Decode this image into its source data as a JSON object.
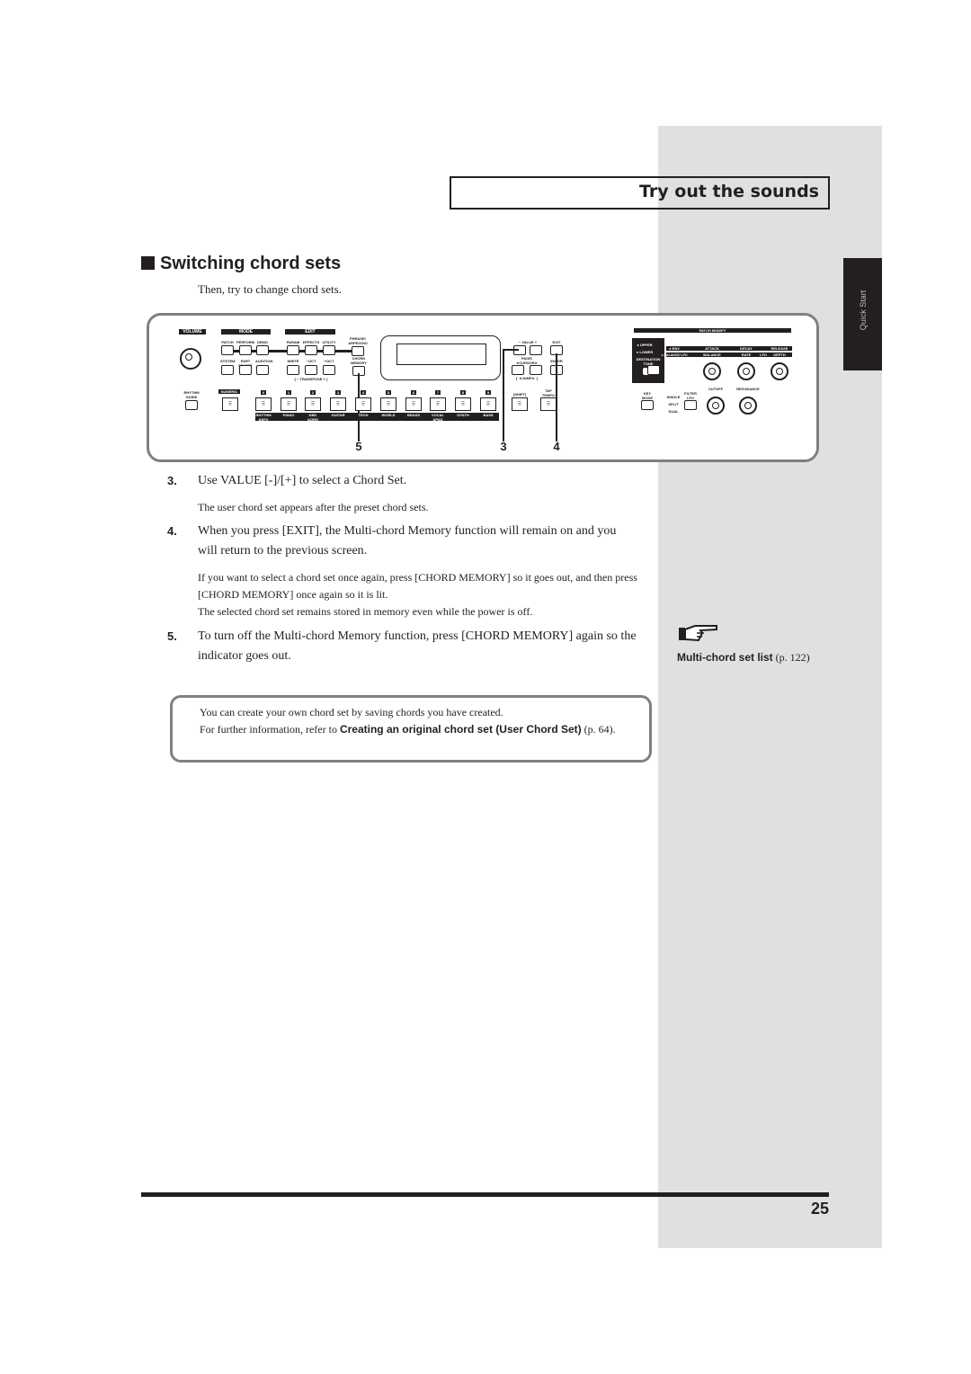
{
  "header": {
    "title": "Try out the sounds"
  },
  "side_tab": {
    "label": "Quick Start"
  },
  "section": {
    "title": "Switching chord sets",
    "intro": "Then, try to change chord sets."
  },
  "panel": {
    "volume": "VOLUME",
    "mode": "MODE",
    "edit": "EDIT",
    "patch_modify": "PATCH MODIFY",
    "top_buttons": [
      "PATCH",
      "PERFORM",
      "DEMO",
      "PARAM",
      "EFFECTS",
      "UTILITY"
    ],
    "second_buttons": [
      "SYSTEM",
      "PART SELECT",
      "AUDITION",
      "WRITE",
      "−OCT",
      "+OCT"
    ],
    "phrase_arpeggio": "PHRASE/ ARPEGGIO",
    "chord_memory": "CHORD MEMORY",
    "transpose": "[ − TRANSPOSE + ]",
    "rhythm_guide": "RHYTHM GUIDE",
    "numeric": "NUMERIC",
    "numbers": [
      "0",
      "1",
      "2",
      "3",
      "4",
      "5",
      "6",
      "7",
      "8",
      "9"
    ],
    "categories": [
      "RHYTHM &SFX",
      "PIANO",
      "KBD &ORG",
      "GUITAR",
      "TECH",
      "WORLD",
      "BRASS",
      "VOCAL &PAD",
      "SYNTH",
      "BASS"
    ],
    "value": "− VALUE +",
    "exit": "EXIT",
    "page_cursor": "PAGE/ ◄CURSOR►",
    "enter": "ENTER",
    "jump": "[ ◄JUMP► ]",
    "shift": "[SHIFT]",
    "tap_tempo": "TAP TEMPO",
    "upper": "● UPPER",
    "lower": "● LOWER",
    "destination_tone": "DESTINATION TONE",
    "env": "● ENV",
    "balance_lfo": "● BALANCE/ LFO",
    "row1": [
      "ATTACK",
      "DECAY",
      "RELEASE"
    ],
    "row2": [
      "BALANCE",
      "RATE",
      "LFO",
      "DEPTH"
    ],
    "key_mode": "KEY MODE",
    "key_modes": [
      "SINGLE",
      "SPLIT",
      "DUAL"
    ],
    "filter_lfo": "FILTER LFO",
    "cutoff": "CUTOFF",
    "resonance": "RESONANCE",
    "callouts": [
      "5",
      "3",
      "4"
    ]
  },
  "steps": [
    {
      "num": "3.",
      "text": "Use VALUE [-]/[+] to select a Chord Set.",
      "notes": [
        "The user chord set appears after the preset chord sets."
      ]
    },
    {
      "num": "4.",
      "text": "When you press [EXIT], the Multi-chord Memory function will remain on and you will return to the previous screen.",
      "notes": [
        "If you want to select a chord set once again, press [CHORD MEMORY] so it goes out, and then press [CHORD MEMORY] once again so it is lit.",
        "The selected chord set remains stored in memory even while the power is off."
      ]
    },
    {
      "num": "5.",
      "text": "To turn off the Multi-chord Memory function, press [CHORD MEMORY] again so the indicator goes out."
    }
  ],
  "memo": {
    "line1": "You can create your own chord set by saving chords you have created.",
    "line2_prefix": "For further information, refer to ",
    "link": "Creating an original chord set (User Chord Set)",
    "line2_suffix": " (p. 64)."
  },
  "reference": {
    "icon": "pointing-hand-icon",
    "link": "Multi-chord set list",
    "page": " (p. 122)"
  },
  "page_number": "25"
}
